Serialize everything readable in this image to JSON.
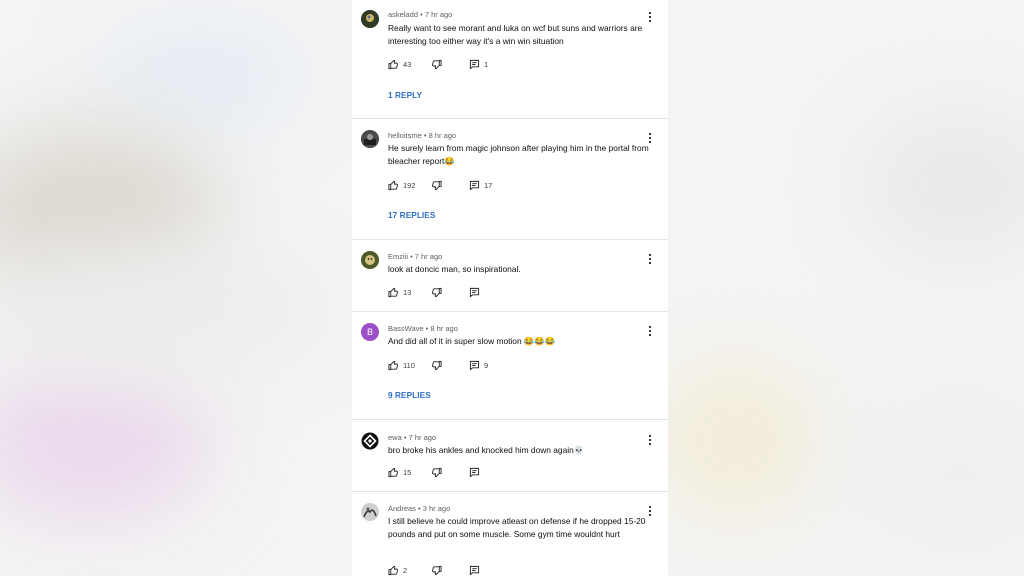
{
  "comments": [
    {
      "author": "askeladd",
      "age": "7 hr ago",
      "text": "Really want to see morant and luka on wcf but suns and warriors are interesting too either way it's a win win situation",
      "likes": "43",
      "reply_count": "1",
      "replies_link": "1 REPLY"
    },
    {
      "author": "helloitsme",
      "age": "8 hr ago",
      "text": "He surely learn from magic johnson after playing him in the portal from bleacher report😂",
      "likes": "192",
      "reply_count": "17",
      "replies_link": "17 REPLIES"
    },
    {
      "author": "Emziii",
      "age": "7 hr ago",
      "text": "look at doncic man, so inspirational.",
      "likes": "13",
      "reply_count": "",
      "replies_link": ""
    },
    {
      "author": "BassWave",
      "age": "8 hr ago",
      "avatar_letter": "B",
      "text": "And did all of it in super slow motion 😂😂😂",
      "likes": "110",
      "reply_count": "9",
      "replies_link": "9 REPLIES"
    },
    {
      "author": "ewa",
      "age": "7 hr ago",
      "text": "bro broke his ankles and knocked him down again💀",
      "likes": "15",
      "reply_count": "",
      "replies_link": ""
    },
    {
      "author": "Andreas",
      "age": "3 hr ago",
      "text": "I still believe he could improve atleast on defense if he dropped 15-20 pounds and put on some muscle. Some gym time wouldnt hurt",
      "likes": "2",
      "reply_count": "",
      "replies_link": ""
    }
  ],
  "colors": {
    "link_blue": "#2e6ec8",
    "avatar_purple": "#9c4fc9",
    "background": "#f4f4f4",
    "panel": "#ffffff"
  },
  "icons": {
    "like": "thumbs-up-icon",
    "dislike": "thumbs-down-icon",
    "reply": "comment-icon",
    "more": "vertical-dots-icon"
  }
}
